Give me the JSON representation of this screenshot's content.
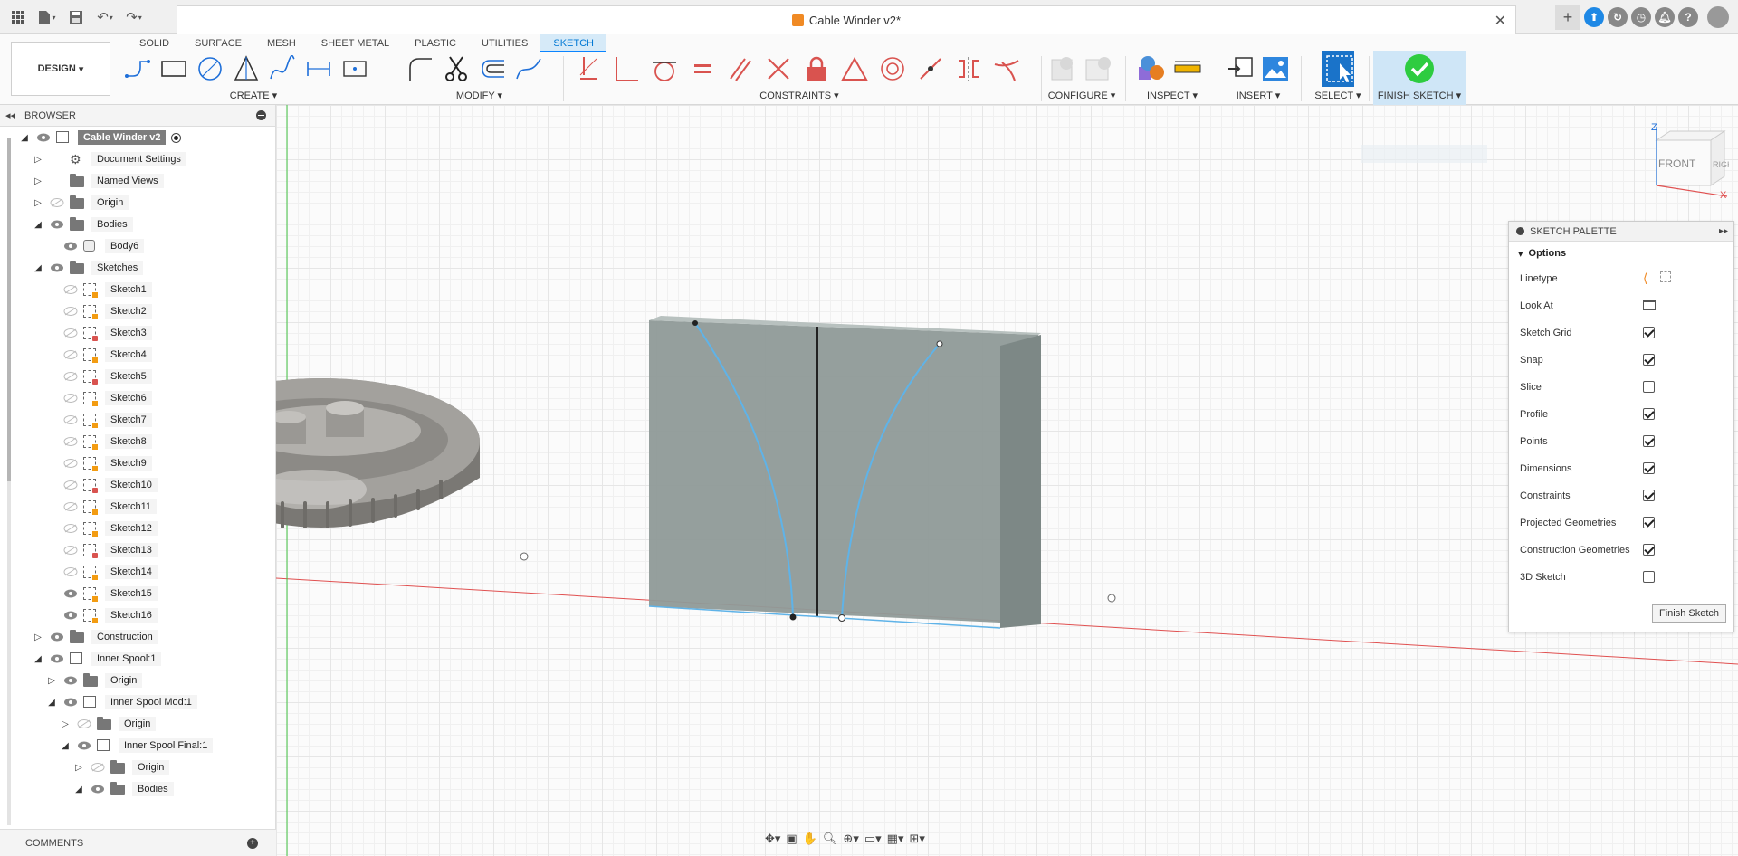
{
  "titlebar": {
    "document_title": "Cable Winder v2*"
  },
  "design_button": {
    "label": "DESIGN"
  },
  "tabs": [
    {
      "label": "SOLID",
      "active": false
    },
    {
      "label": "SURFACE",
      "active": false
    },
    {
      "label": "MESH",
      "active": false
    },
    {
      "label": "SHEET METAL",
      "active": false
    },
    {
      "label": "PLASTIC",
      "active": false
    },
    {
      "label": "UTILITIES",
      "active": false
    },
    {
      "label": "SKETCH",
      "active": true
    }
  ],
  "groups": {
    "create": "CREATE",
    "modify": "MODIFY",
    "constraints": "CONSTRAINTS",
    "configure": "CONFIGURE",
    "inspect": "INSPECT",
    "insert": "INSERT",
    "select": "SELECT",
    "finish": "FINISH SKETCH"
  },
  "browser": {
    "title": "BROWSER",
    "items": [
      {
        "label": "Cable Winder v2"
      },
      {
        "label": "Document Settings"
      },
      {
        "label": "Named Views"
      },
      {
        "label": "Origin"
      },
      {
        "label": "Bodies"
      },
      {
        "label": "Body6"
      },
      {
        "label": "Sketches"
      },
      {
        "label": "Sketch1"
      },
      {
        "label": "Sketch2"
      },
      {
        "label": "Sketch3"
      },
      {
        "label": "Sketch4"
      },
      {
        "label": "Sketch5"
      },
      {
        "label": "Sketch6"
      },
      {
        "label": "Sketch7"
      },
      {
        "label": "Sketch8"
      },
      {
        "label": "Sketch9"
      },
      {
        "label": "Sketch10"
      },
      {
        "label": "Sketch11"
      },
      {
        "label": "Sketch12"
      },
      {
        "label": "Sketch13"
      },
      {
        "label": "Sketch14"
      },
      {
        "label": "Sketch15"
      },
      {
        "label": "Sketch16"
      },
      {
        "label": "Construction"
      },
      {
        "label": "Inner Spool:1"
      },
      {
        "label": "Origin"
      },
      {
        "label": "Inner Spool Mod:1"
      },
      {
        "label": "Origin"
      },
      {
        "label": "Inner Spool Final:1"
      },
      {
        "label": "Origin"
      },
      {
        "label": "Bodies"
      }
    ]
  },
  "comments": {
    "label": "COMMENTS"
  },
  "palette": {
    "title": "SKETCH PALETTE",
    "section": "Options",
    "rows": [
      {
        "label": "Linetype"
      },
      {
        "label": "Look At"
      },
      {
        "label": "Sketch Grid",
        "checked": true
      },
      {
        "label": "Snap",
        "checked": true
      },
      {
        "label": "Slice",
        "checked": false
      },
      {
        "label": "Profile",
        "checked": true
      },
      {
        "label": "Points",
        "checked": true
      },
      {
        "label": "Dimensions",
        "checked": true
      },
      {
        "label": "Constraints",
        "checked": true
      },
      {
        "label": "Projected Geometries",
        "checked": true
      },
      {
        "label": "Construction Geometries",
        "checked": true
      },
      {
        "label": "3D Sketch",
        "checked": false
      }
    ],
    "finish_button": "Finish Sketch"
  },
  "viewcube": {
    "front": "FRONT",
    "right": "RIGHT",
    "z": "Z",
    "x": "X"
  }
}
